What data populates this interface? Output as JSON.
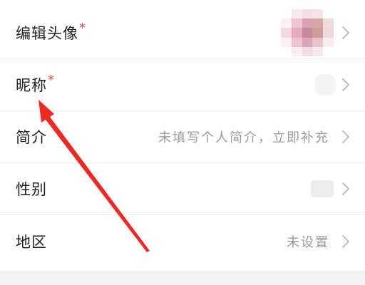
{
  "settings": {
    "rows": [
      {
        "label": "编辑头像",
        "required": "*",
        "value": ""
      },
      {
        "label": "昵称",
        "required": "*",
        "value": ""
      },
      {
        "label": "简介",
        "required": "",
        "value": "未填写个人简介，立即补充"
      },
      {
        "label": "性别",
        "required": "",
        "value": ""
      },
      {
        "label": "地区",
        "required": "",
        "value": "未设置"
      }
    ]
  },
  "colors": {
    "required_mark": "#e5484d",
    "value_text": "#9b9b9b",
    "annotation_arrow": "#ec2a24"
  },
  "icons": {
    "row_chevron": "chevron-right-icon"
  }
}
